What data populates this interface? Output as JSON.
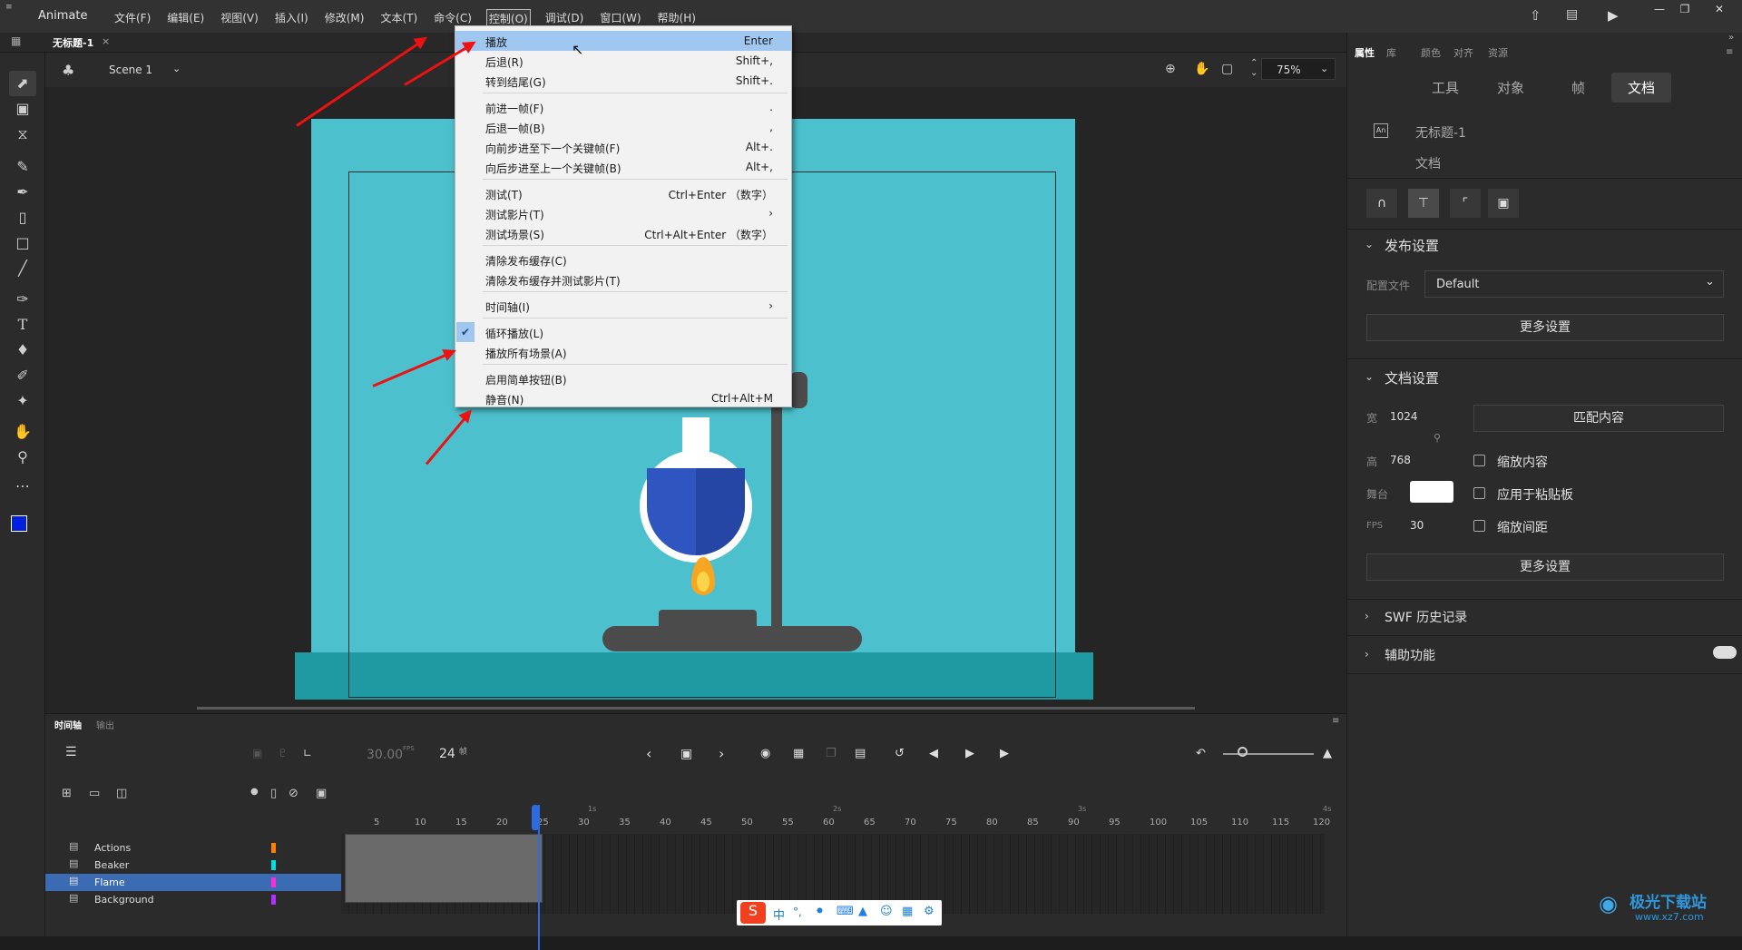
{
  "app": {
    "name": "Animate"
  },
  "menubar": [
    "文件(F)",
    "编辑(E)",
    "视图(V)",
    "插入(I)",
    "修改(M)",
    "文本(T)",
    "命令(C)",
    "控制(O)",
    "调试(D)",
    "窗口(W)",
    "帮助(H)"
  ],
  "document_tab": "无标题-1",
  "stage": {
    "scene": "Scene 1",
    "zoom": "75%"
  },
  "control_menu": [
    {
      "label": "播放",
      "shortcut": "Enter"
    },
    {
      "label": "后退(R)",
      "shortcut": "Shift+,"
    },
    {
      "label": "转到结尾(G)",
      "shortcut": "Shift+."
    },
    {
      "label": "前进一帧(F)",
      "shortcut": "."
    },
    {
      "label": "后退一帧(B)",
      "shortcut": ","
    },
    {
      "label": "向前步进至下一个关键帧(F)",
      "shortcut": "Alt+."
    },
    {
      "label": "向后步进至上一个关键帧(B)",
      "shortcut": "Alt+,"
    },
    {
      "label": "测试(T)",
      "shortcut": "Ctrl+Enter （数字）"
    },
    {
      "label": "测试影片(T)",
      "shortcut": "›"
    },
    {
      "label": "测试场景(S)",
      "shortcut": "Ctrl+Alt+Enter （数字）"
    },
    {
      "label": "清除发布缓存(C)",
      "shortcut": ""
    },
    {
      "label": "清除发布缓存并测试影片(T)",
      "shortcut": ""
    },
    {
      "label": "时间轴(I)",
      "shortcut": "›"
    },
    {
      "label": "循环播放(L)",
      "shortcut": ""
    },
    {
      "label": "播放所有场景(A)",
      "shortcut": ""
    },
    {
      "label": "启用简单按钮(B)",
      "shortcut": ""
    },
    {
      "label": "静音(N)",
      "shortcut": "Ctrl+Alt+M"
    }
  ],
  "panel": {
    "tabs": [
      "属性",
      "库",
      "颜色",
      "对齐",
      "资源"
    ],
    "subtabs": [
      "工具",
      "对象",
      "帧",
      "文档"
    ],
    "doc_name": "无标题-1",
    "doc_kind": "文档",
    "publish_title": "发布设置",
    "profile_label": "配置文件",
    "profile_value": "Default",
    "more_settings": "更多设置",
    "docsettings_title": "文档设置",
    "width_label": "宽",
    "width": "1024",
    "height_label": "高",
    "height": "768",
    "stage_label": "舞台",
    "fps_label": "FPS",
    "fps": "30",
    "match_contents": "匹配内容",
    "scale_content": "缩放内容",
    "apply_pasteboard": "应用于粘贴板",
    "scale_spacing": "缩放间距",
    "swf_history": "SWF 历史记录",
    "accessibility": "辅助功能"
  },
  "timeline": {
    "tabs": [
      "时间轴",
      "输出"
    ],
    "fps": "30.00",
    "fps_unit": "FPS",
    "frame": "24",
    "frame_unit": "帧",
    "ruler": [
      "5",
      "10",
      "15",
      "20",
      "25",
      "30",
      "35",
      "40",
      "45",
      "50",
      "55",
      "60",
      "65",
      "70",
      "75",
      "80",
      "85",
      "90",
      "95",
      "100",
      "105",
      "110",
      "115",
      "120"
    ],
    "seconds": [
      "1s",
      "2s",
      "3s",
      "4s"
    ],
    "layers": [
      "Actions",
      "Beaker",
      "Flame",
      "Background"
    ],
    "layer_colors": [
      "#ff7f00",
      "#00e0e0",
      "#ff2bd6",
      "#b030ff"
    ]
  },
  "ime": [
    "中",
    "°,"
  ],
  "watermark": "极光下载站",
  "watermark_url": "www.xz7.com"
}
